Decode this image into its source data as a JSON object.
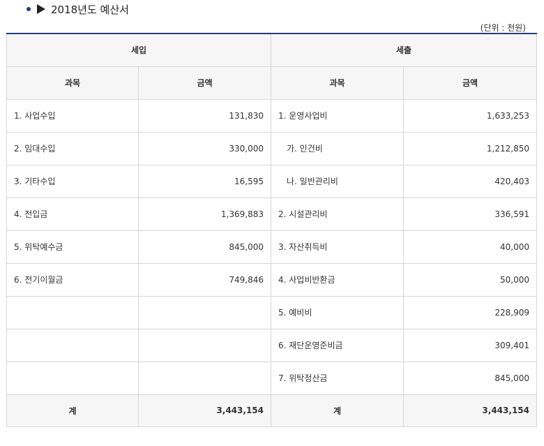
{
  "page_title": "2018년도 예산서",
  "unit_note": "(단위 : 천원)",
  "headers": {
    "income": "세입",
    "expense": "세출",
    "subject": "과목",
    "amount": "금액"
  },
  "rows": [
    {
      "income_item": "1. 사업수입",
      "income_amount": "131,830",
      "expense_item": "1. 운영사업비",
      "expense_amount": "1,633,253"
    },
    {
      "income_item": "2. 임대수입",
      "income_amount": "330,000",
      "expense_item": "가. 인건비",
      "expense_amount": "1,212,850"
    },
    {
      "income_item": "3. 기타수입",
      "income_amount": "16,595",
      "expense_item": "나. 일반관리비",
      "expense_amount": "420,403"
    },
    {
      "income_item": "4. 전입금",
      "income_amount": "1,369,883",
      "expense_item": "2. 시설관리비",
      "expense_amount": "336,591"
    },
    {
      "income_item": "5. 위탁예수금",
      "income_amount": "845,000",
      "expense_item": "3. 자산취득비",
      "expense_amount": "40,000"
    },
    {
      "income_item": "6. 전기이월금",
      "income_amount": "749,846",
      "expense_item": "4. 사업비반환금",
      "expense_amount": "50,000"
    },
    {
      "income_item": "",
      "income_amount": "",
      "expense_item": "5. 예비비",
      "expense_amount": "228,909"
    },
    {
      "income_item": "",
      "income_amount": "",
      "expense_item": "6. 재단운영준비금",
      "expense_amount": "309,401"
    },
    {
      "income_item": "",
      "income_amount": "",
      "expense_item": "7. 위탁정산금",
      "expense_amount": "845,000"
    }
  ],
  "totals": {
    "income_label": "계",
    "income_total": "3,443,154",
    "expense_label": "계",
    "expense_total": "3,443,154"
  },
  "colors": {
    "accent": "#1f3c88",
    "header_bg": "#f6f6f6",
    "border": "#d7d7d7"
  }
}
